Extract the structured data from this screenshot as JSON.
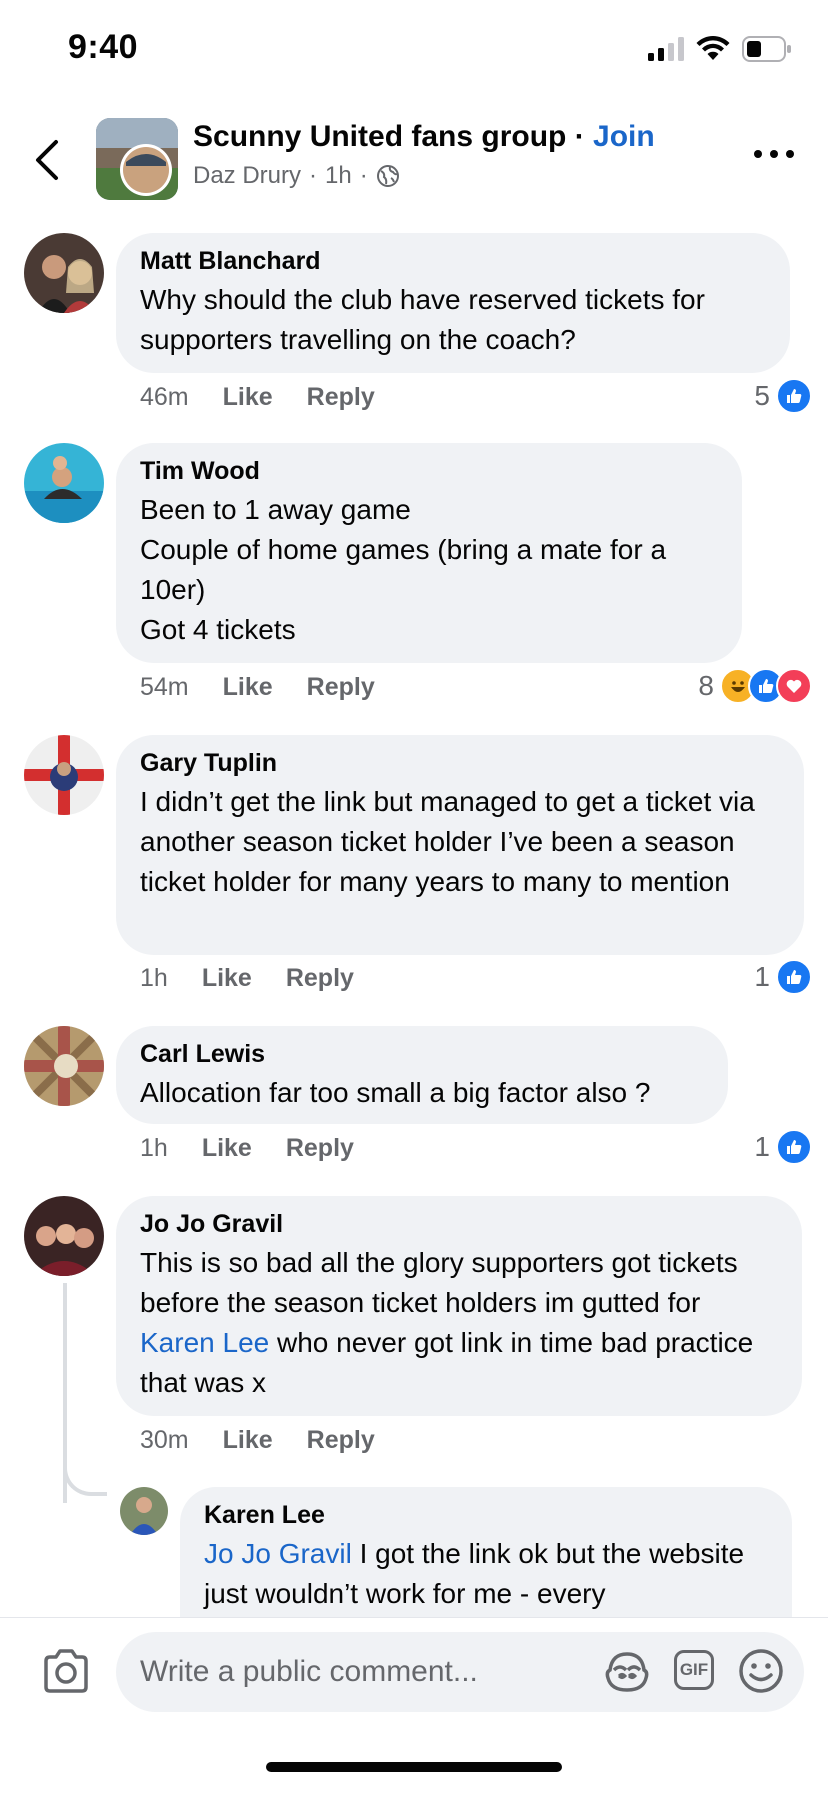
{
  "status": {
    "time": "9:40"
  },
  "header": {
    "title": "Scunny United fans group",
    "separator": " · ",
    "join_label": "Join",
    "author": "Daz Drury",
    "age": "1h",
    "dot": "·"
  },
  "comments": [
    {
      "name": "Matt Blanchard",
      "text": "Why should the club have reserved tickets for supporters travelling on the coach?",
      "time": "46m",
      "like": "Like",
      "reply": "Reply",
      "reaction_count": "5"
    },
    {
      "name": "Tim Wood",
      "lines": [
        "Been to 1 away game",
        "Couple of home games (bring a mate for a 10er)",
        "Got 4 tickets"
      ],
      "time": "54m",
      "like": "Like",
      "reply": "Reply",
      "reaction_count": "8"
    },
    {
      "name": "Gary Tuplin",
      "text": "I didn’t get the link but managed to get a ticket via another season ticket holder I’ve been a season ticket holder for many years to many to mention",
      "time": "1h",
      "like": "Like",
      "reply": "Reply",
      "reaction_count": "1"
    },
    {
      "name": "Carl Lewis",
      "text": "Allocation far too small a big factor also ?",
      "time": "1h",
      "like": "Like",
      "reply": "Reply",
      "reaction_count": "1"
    },
    {
      "name": "Jo Jo Gravil",
      "text_before": "This is so bad all the glory supporters got tickets before the season ticket holders im gutted for ",
      "mention": "Karen Lee",
      "text_after": " who never got link in time bad practice that was x",
      "time": "30m",
      "like": "Like",
      "reply": "Reply"
    }
  ],
  "reply": {
    "name": "Karen Lee",
    "mention": "Jo Jo Gravil",
    "text_after": " I got the link ok but the website just wouldn’t work for me - every"
  },
  "composer": {
    "placeholder": "Write a public comment...",
    "gif_label": "GIF"
  },
  "colors": {
    "link": "#1a66c9",
    "like": "#1877f2",
    "love": "#f33e58",
    "bubble": "#f0f2f5"
  }
}
